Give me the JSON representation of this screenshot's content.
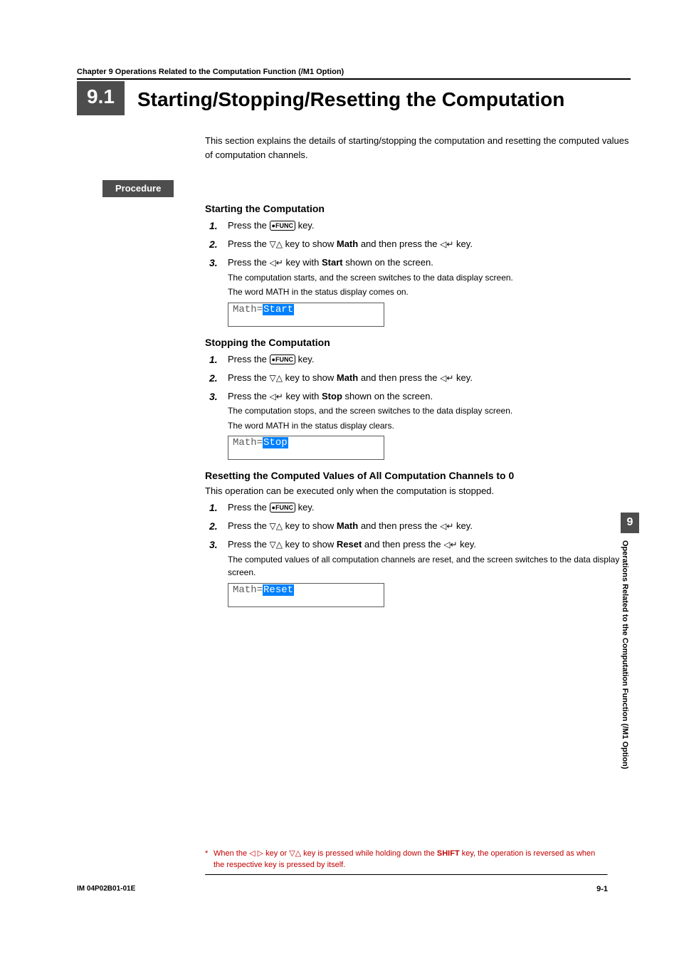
{
  "chapter_line": "Chapter 9    Operations Related to the Computation Function (/M1 Option)",
  "section_num": "9.1",
  "section_title": "Starting/Stopping/Resetting the Computation",
  "intro": "This section explains the details of starting/stopping the computation and resetting the computed values of computation channels.",
  "procedure_label": "Procedure",
  "key_func": "FUNC",
  "and_then_press": " and then press the ",
  "key_text_key": " key.",
  "press_the": "Press the ",
  "key_to_show": " key to show ",
  "key_with": " key with ",
  "shown_on_screen": " shown on the screen.",
  "math_word": "Math",
  "start": {
    "heading": "Starting the Computation",
    "s3_bold": "Start",
    "s3_sub1": "The computation starts, and the screen switches to the data display screen.",
    "s3_sub2": "The word MATH in the status display comes on.",
    "disp_prefix": "Math=",
    "disp_val": "Start"
  },
  "stop": {
    "heading": "Stopping the Computation",
    "s3_bold": "Stop",
    "s3_sub1": "The computation stops, and the screen switches to the data display screen.",
    "s3_sub2": "The word MATH in the status display clears.",
    "disp_prefix": "Math=",
    "disp_val": "Stop"
  },
  "reset": {
    "heading": "Resetting the Computed Values of All Computation Channels to 0",
    "note": "This operation can be executed only when the computation is stopped.",
    "s3_bold": "Reset",
    "s3_sub": "The computed values of all computation channels are reset, and the screen switches to the data display screen.",
    "disp_prefix": "Math=",
    "disp_val": "Reset"
  },
  "side": {
    "num": "9",
    "text": "Operations Related to the Computation Function (/M1 Option)"
  },
  "footnote": {
    "ast": "*",
    "t1": "When the ",
    "t2": " key or ",
    "t3": " key is pressed while holding down the ",
    "shift": "SHIFT",
    "t4": " key, the operation is reversed as when the respective key is pressed by itself."
  },
  "footer": {
    "left": "IM 04P02B01-01E",
    "right": "9-1"
  }
}
